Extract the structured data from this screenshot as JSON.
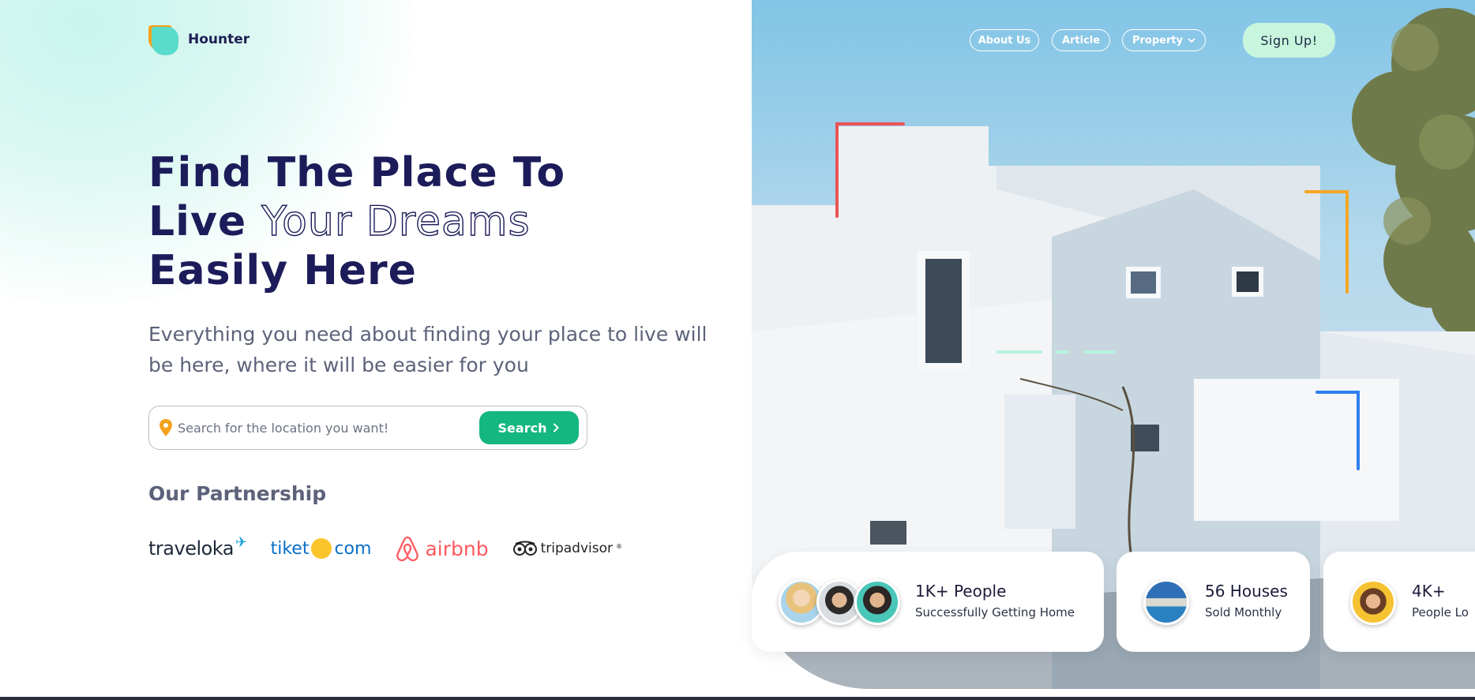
{
  "brand": {
    "name": "Hounter"
  },
  "nav": {
    "about": "About Us",
    "article": "Article",
    "property": "Property",
    "signup": "Sign Up!"
  },
  "hero": {
    "line1": "Find The Place To",
    "line2_solid": "Live",
    "line2_outline": "Your Dreams",
    "line3": "Easily Here",
    "subtitle": "Everything you need about finding your place to live will be here, where it will be easier for you"
  },
  "search": {
    "placeholder": "Search for the location you want!",
    "value": "",
    "button": "Search"
  },
  "partnership": {
    "title": "Our Partnership",
    "partners": [
      "traveloka",
      "tiket",
      "com",
      "airbnb",
      "tripadvisor"
    ]
  },
  "stats": [
    {
      "value": "1K+ People",
      "label": "Successfully Getting Home"
    },
    {
      "value": "56 Houses",
      "label": "Sold Monthly"
    },
    {
      "value": "4K+",
      "label": "People Lo"
    }
  ],
  "colors": {
    "primary_dark": "#1c1c5a",
    "accent_green": "#14b780",
    "signup_bg": "#c8f5dd",
    "logo_orange": "#f4a21d",
    "logo_teal": "#59dccb",
    "frame_red": "#ea5455",
    "frame_orange": "#f5a623",
    "frame_blue": "#2f80ed"
  },
  "icons": [
    "location-pin-icon",
    "chevron-right-icon",
    "chevron-down-icon",
    "airbnb-logo-icon",
    "tripadvisor-owl-icon"
  ]
}
